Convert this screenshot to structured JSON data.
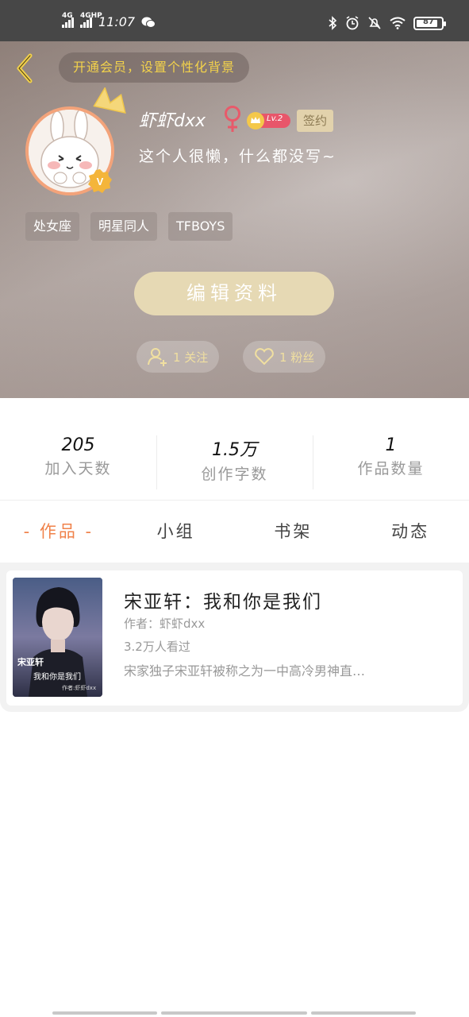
{
  "status_bar": {
    "net1": "4G",
    "net2": "4GHP",
    "time": "11:07",
    "battery": "87",
    "battery_level": 0.87
  },
  "header": {
    "vip_banner": "开通会员，设置个性化背景",
    "username": "虾虾dxx",
    "level": "Lv.2",
    "sign_badge": "签约",
    "bio": "这个人很懒，什么都没写~",
    "tags": [
      "处女座",
      "明星同人",
      "TFBOYS"
    ],
    "edit_button": "编辑资料",
    "follow": "1 关注",
    "fans": "1 粉丝"
  },
  "stats": [
    {
      "value": "205",
      "label": "加入天数"
    },
    {
      "value": "1.5万",
      "label": "创作字数"
    },
    {
      "value": "1",
      "label": "作品数量"
    }
  ],
  "tabs": [
    "- 作品 -",
    "小组",
    "书架",
    "动态"
  ],
  "work": {
    "title": "宋亚轩：我和你是我们",
    "author": "作者：虾虾dxx",
    "views": "3.2万人看过",
    "description": "宋家独子宋亚轩被称之为一中高冷男神直…",
    "cover_line1": "宋亚轩",
    "cover_line2": "我和你是我们",
    "cover_line3": "作者:虾虾dxx"
  },
  "colors": {
    "accent": "#f0824a",
    "vip_text": "#f3d24b",
    "edit_button_bg": "#e6d9b4"
  }
}
